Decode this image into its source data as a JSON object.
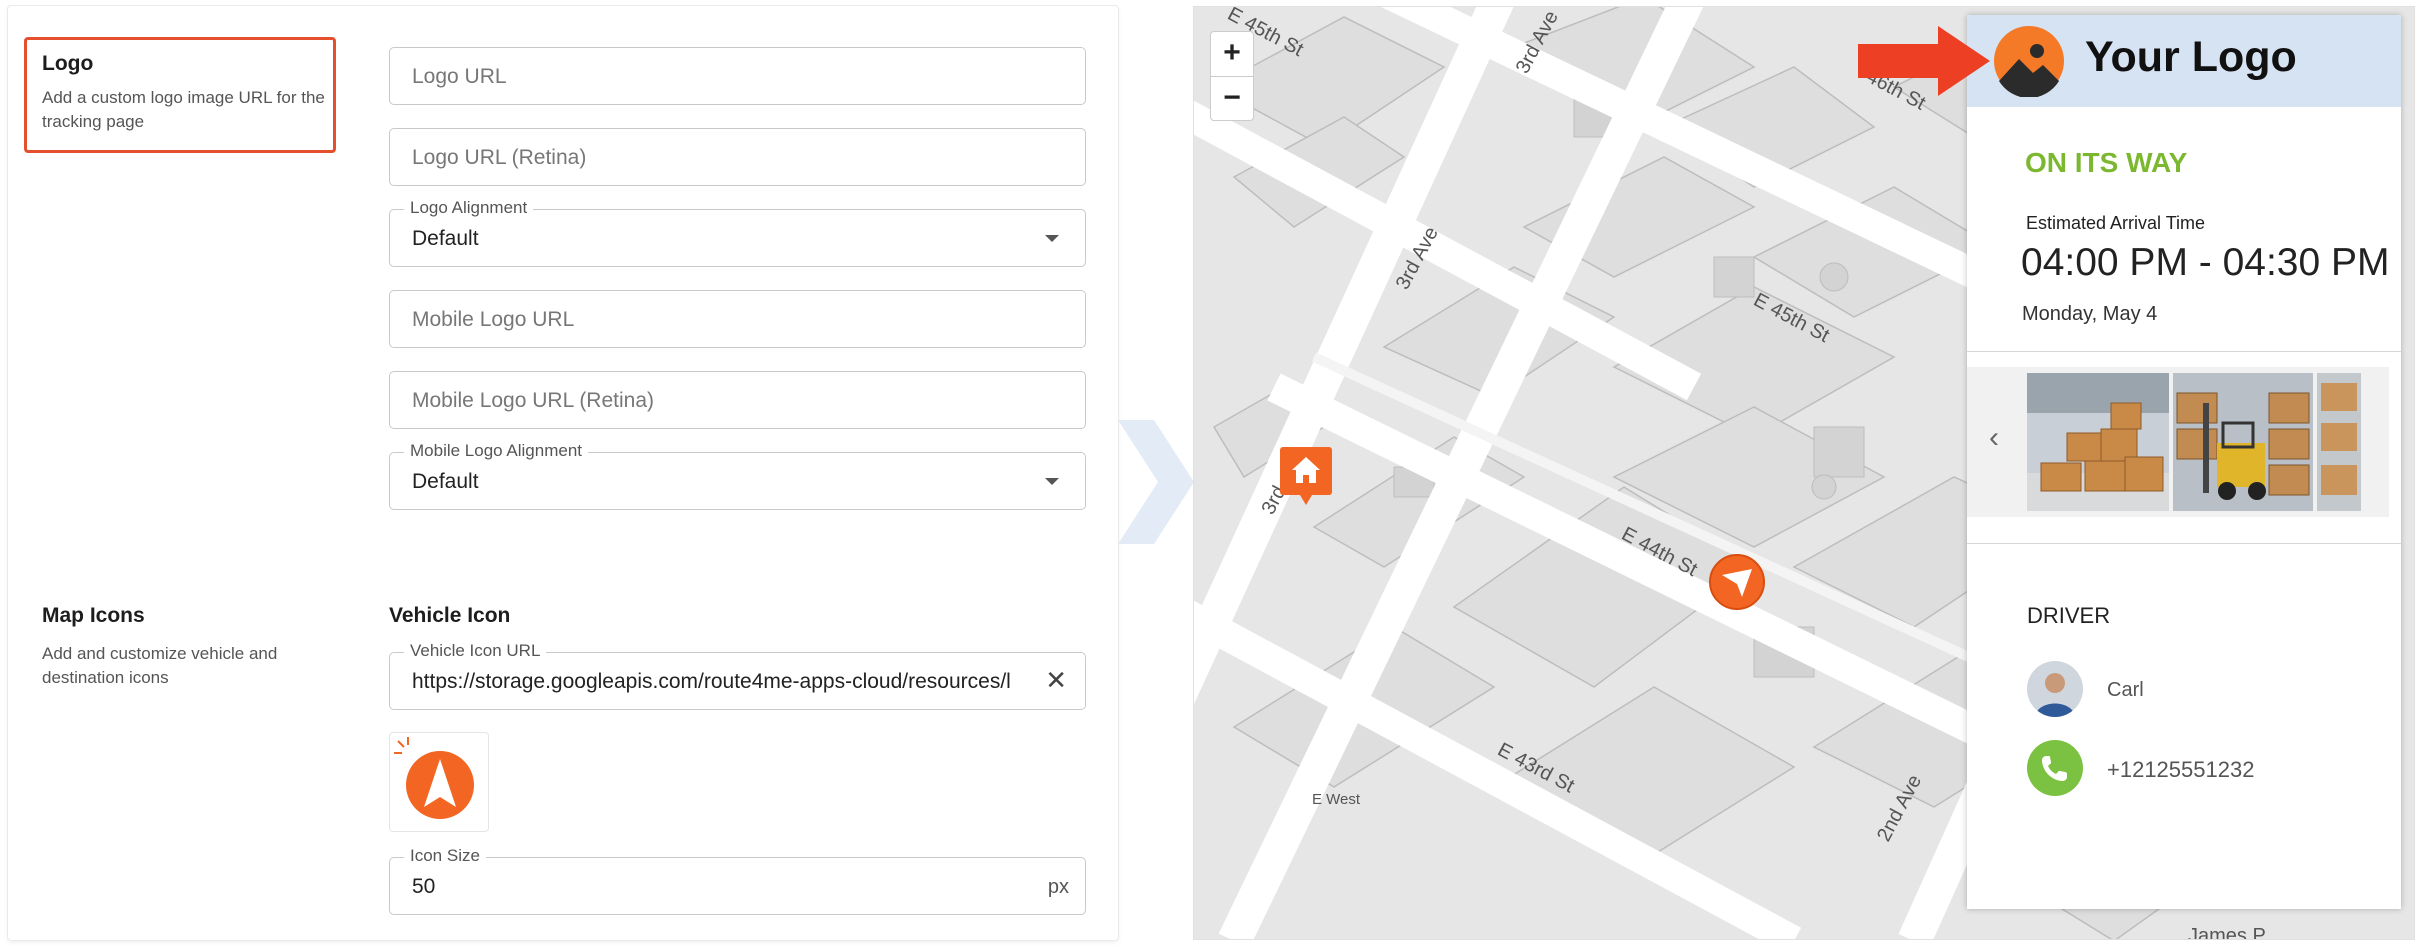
{
  "logo_section": {
    "title": "Logo",
    "description": "Add a custom logo image URL for the tracking page",
    "fields": {
      "logo_url_placeholder": "Logo URL",
      "logo_url_retina_placeholder": "Logo URL (Retina)",
      "logo_alignment_label": "Logo Alignment",
      "logo_alignment_value": "Default",
      "mobile_logo_url_placeholder": "Mobile Logo URL",
      "mobile_logo_url_retina_placeholder": "Mobile Logo URL (Retina)",
      "mobile_logo_alignment_label": "Mobile Logo Alignment",
      "mobile_logo_alignment_value": "Default"
    }
  },
  "map_icons_section": {
    "title": "Map Icons",
    "description": "Add and customize vehicle and destination icons",
    "vehicle_icon_title": "Vehicle Icon",
    "vehicle_icon_url_label": "Vehicle Icon URL",
    "vehicle_icon_url_value": "https://storage.googleapis.com/route4me-apps-cloud/resources/l",
    "icon_size_label": "Icon Size",
    "icon_size_value": "50",
    "icon_size_unit": "px"
  },
  "map": {
    "zoom_in": "+",
    "zoom_out": "−",
    "streets": [
      "E 45th St",
      "3rd Ave",
      "46th St",
      "3rd Ave",
      "E 45th St",
      "3rd",
      "E 44th St",
      "E 43rd St",
      "E West",
      "2nd Ave",
      "James P"
    ]
  },
  "tracking_card": {
    "brand": "Your Logo",
    "status": "ON ITS WAY",
    "eta_label": "Estimated Arrival Time",
    "eta_value": "04:00 PM - 04:30 PM",
    "eta_date": "Monday, May 4",
    "driver_title": "DRIVER",
    "driver_name": "Carl",
    "driver_phone": "+12125551232"
  },
  "colors": {
    "accent_orange": "#f26522",
    "highlight_red": "#e4502e",
    "status_green": "#7cb82f",
    "header_blue": "#d6e3f3"
  }
}
